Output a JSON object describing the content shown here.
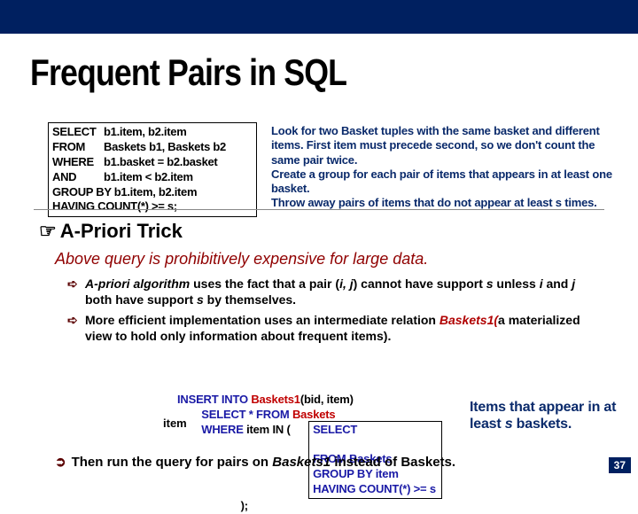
{
  "title": "Frequent Pairs in SQL",
  "sql": {
    "l1kw": "SELECT",
    "l1": "b1.item, b2.item",
    "l2kw": "FROM",
    "l2": "Baskets b1, Baskets b2",
    "l3kw": "WHERE",
    "l3": "b1.basket = b2.basket",
    "l4kw": "  AND",
    "l4": "b1.item < b2.item",
    "l5": "GROUP BY b1.item, b2.item",
    "l6": "HAVING COUNT(*) >= s;"
  },
  "explanation": {
    "p1": "Look for two Basket tuples with the same basket and different items. First item must precede second, so we don't count the same pair twice.",
    "p2": "Create a group for each pair of items that appears in at least one basket.",
    "p3": "Throw away pairs of items that do not appear at least s  times."
  },
  "apriori_heading": "A-Priori Trick",
  "expensive": "Above query is prohibitively expensive for large data.",
  "bullet1": {
    "a": "A-priori algorithm",
    "b": " uses the fact that a pair (",
    "c": "i, j",
    "d": ") cannot have support ",
    "e": "s",
    "f": " unless ",
    "g": "i",
    "h": " and ",
    "i": "j",
    "j": " both have support ",
    "k": "s",
    "l": " by themselves."
  },
  "bullet2": {
    "a": "More efficient implementation uses an intermediate relation ",
    "b": "Baskets1(",
    "c": "a materialized view to hold only information about frequent items)."
  },
  "insert": {
    "ins": "INSERT INTO ",
    "tbl": "Baskets1",
    "bi": "(bid, item)",
    "sel": "        SELECT * FROM ",
    "bas": "Baskets",
    "whr": "        WHERE ",
    "iin": "item IN (",
    "ssel": "SELECT",
    "sfrom": "FROM Baskets",
    "sgrp": "GROUP BY item",
    "shav": "HAVING COUNT(*) >= s",
    "close": ");"
  },
  "itemlabel": "item",
  "items_appear": {
    "a": "Items that appear in at least ",
    "s": "s",
    "b": "  baskets."
  },
  "then": {
    "a": "Then run the query for pairs on ",
    "b": "Baskets1",
    "c": " instead of Baskets."
  },
  "pagenum": "37"
}
